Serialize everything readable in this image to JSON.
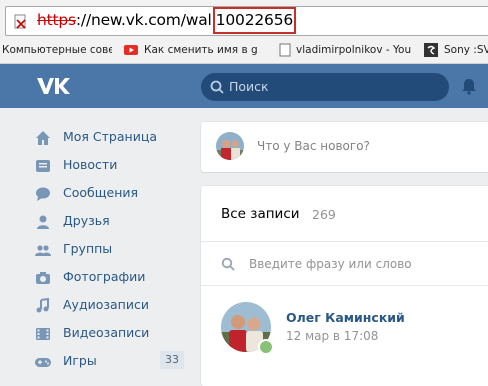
{
  "browser": {
    "url_scheme": "https",
    "url_rest": "://new.vk.com/wall",
    "url_highlight": "10022656",
    "bookmarks": [
      {
        "label": "Компьютерные сове",
        "icon": "folder-icon"
      },
      {
        "label": "Как сменить имя в g",
        "icon": "youtube-icon"
      },
      {
        "label": "vladimirpolnikov - You",
        "icon": "page-icon"
      },
      {
        "label": "Sony :SV",
        "icon": "sony-icon"
      }
    ]
  },
  "header": {
    "logo": "vk-logo",
    "search_placeholder": "Поиск",
    "accent": "#4a76a8"
  },
  "sidebar": {
    "items": [
      {
        "label": "Моя Страница",
        "icon": "home-icon"
      },
      {
        "label": "Новости",
        "icon": "news-icon"
      },
      {
        "label": "Сообщения",
        "icon": "messages-icon"
      },
      {
        "label": "Друзья",
        "icon": "user-icon"
      },
      {
        "label": "Группы",
        "icon": "groups-icon"
      },
      {
        "label": "Фотографии",
        "icon": "camera-icon"
      },
      {
        "label": "Аудиозаписи",
        "icon": "music-icon"
      },
      {
        "label": "Видеозаписи",
        "icon": "video-icon"
      },
      {
        "label": "Игры",
        "icon": "gamepad-icon",
        "count": "33"
      }
    ]
  },
  "composer": {
    "placeholder": "Что у Вас нового?"
  },
  "wall": {
    "title": "Все записи",
    "count": "269",
    "search_placeholder": "Введите фразу или слово",
    "post": {
      "author": "Олег Каминский",
      "date": "12 мар в 17:08"
    }
  }
}
